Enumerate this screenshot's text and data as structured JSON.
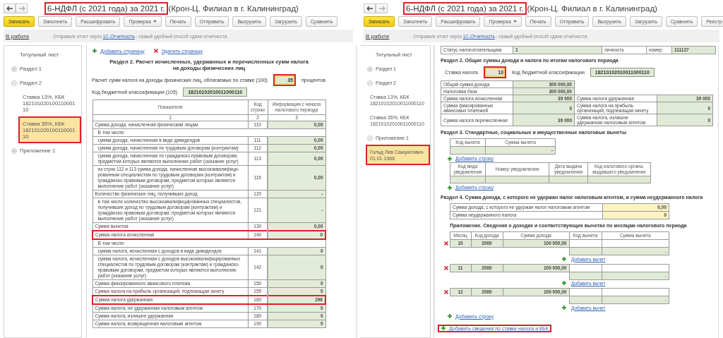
{
  "windows": [
    {
      "nav": {
        "title": "6-НДФЛ (с 2021 года) за 2021 г.",
        "subtitle": "(Крон-Ц. Филиал в г. Калининград)",
        "title_highlighted": true
      },
      "toolbar": [
        {
          "label": "Записать",
          "kind": "primary"
        },
        {
          "label": "Заполнить",
          "kind": "plain"
        },
        {
          "label": "Расшифровать",
          "kind": "plain"
        },
        {
          "label": "Проверка",
          "kind": "menu"
        },
        {
          "label": "Печать",
          "kind": "plain"
        },
        {
          "label": "Отправить",
          "kind": "plain"
        },
        {
          "label": "Выгрузить",
          "kind": "plain"
        },
        {
          "label": "Загрузить",
          "kind": "plain"
        },
        {
          "label": "Сравнить",
          "kind": "plain"
        }
      ],
      "status_link": "В работе",
      "notice": {
        "before": "Отправьте отчет через",
        "link": "1С-Отчетность",
        "after": "- самый удобный способ сдачи отчетности."
      },
      "sidebar": [
        {
          "label": "Титульный лист",
          "selected": false,
          "highlighted": false
        },
        {
          "label": "Раздел 1",
          "expanded": false,
          "selected": false,
          "highlighted": false
        },
        {
          "label": "Раздел 2",
          "expanded": true,
          "selected": false,
          "highlighted": false,
          "children": [
            {
              "label": "Ставка 13%, КБК 18210102010011000110",
              "selected": false,
              "highlighted": false
            },
            {
              "label": "Ставка 35%, КБК 18210102010011000110",
              "selected": true,
              "highlighted": true
            }
          ]
        },
        {
          "label": "Приложение 1",
          "expanded": false,
          "selected": false,
          "highlighted": false
        }
      ],
      "blocks": [
        {
          "kind": "page_links",
          "links": [
            {
              "kind": "add",
              "text": "Добавить страницу"
            },
            {
              "kind": "remove",
              "text": "Удалить страницу"
            }
          ]
        },
        {
          "kind": "title",
          "text": "Раздел 2. Расчет исчисленных, удержанных и перечисленных сумм налога на доходы физических лиц"
        },
        {
          "kind": "rate_line",
          "label": "Расчет сумм налога на доходы физических лиц, облагаемых по ставке  (100)",
          "value": "35",
          "suffix": "процентов",
          "highlighted": true
        },
        {
          "kind": "kbk_line",
          "label": "Код бюджетной классификации  (105)",
          "value": "18210102010011000110"
        },
        {
          "kind": "indicator_table",
          "columns": [
            "Показатели",
            "Код строки",
            "Информация с начала налогового периода"
          ],
          "numbers": [
            "1",
            "2",
            "3"
          ],
          "rows": [
            {
              "kind": "main",
              "label": "Сумма дохода, начисленная физическим лицам",
              "code": "110",
              "value": "0,00",
              "highlighted": false
            },
            {
              "kind": "note",
              "label": "В том числе:",
              "highlighted": false
            },
            {
              "kind": "sub",
              "label": "сумма дохода, начисленная в виде дивидендов",
              "code": "111",
              "value": "0,00",
              "highlighted": false
            },
            {
              "kind": "sub",
              "label": "сумма дохода, начисленная по трудовым договорам (контрактам)",
              "code": "112",
              "value": "0,00",
              "highlighted": false
            },
            {
              "kind": "sub",
              "label": "сумма дохода, начисленная по гражданско-правовым договорам, предметом которых являются выполнение работ (оказание услуг)",
              "code": "113",
              "value": "0,00",
              "highlighted": false
            },
            {
              "kind": "sub",
              "label": "из строк 112 и 113 сумма дохода, начисленная высококвалифици-рованным специалистам по трудовым договорам (контрактам) и гражданско-правовым договорам, предметом которых являются выполнение работ (оказание услуг)",
              "code": "115",
              "value": "0,00",
              "highlighted": false
            },
            {
              "kind": "main",
              "label": "Количество физических лиц, получивших доход",
              "code": "120",
              "value": "-",
              "highlighted": false
            },
            {
              "kind": "sub",
              "label": "в том числе количество высококвалифицированных специалистов, получивших доход по трудовым договорам (контрактам) и гражданско-правовым договорам, предметом которых являются выполнение работ (оказание услуг)",
              "code": "121",
              "value": "-",
              "highlighted": false
            },
            {
              "kind": "main",
              "label": "Сумма вычетов",
              "code": "130",
              "value": "0,00",
              "highlighted": false
            },
            {
              "kind": "main",
              "label": "Сумма налога исчисленная",
              "code": "140",
              "value": "0",
              "highlighted": true
            },
            {
              "kind": "note",
              "label": "В том числе:",
              "highlighted": false
            },
            {
              "kind": "sub",
              "label": "сумма налога, исчисленная с доходов в виде дивидендов",
              "code": "141",
              "value": "0",
              "highlighted": false
            },
            {
              "kind": "sub",
              "label": "сумма налога, исчисленная с доходов высококвалифицированных специалистов по трудовым договорам (контрактам) и гражданско-правовым договорам, предметом которых являются выполнение работ (оказание услуг)",
              "code": "142",
              "value": "0",
              "highlighted": false
            },
            {
              "kind": "main",
              "label": "Сумма фиксированного авансового платежа",
              "code": "150",
              "value": "0",
              "highlighted": false
            },
            {
              "kind": "main",
              "label": "Сумма налога на прибыль организаций, подлежащая зачету",
              "code": "155",
              "value": "0",
              "highlighted": false
            },
            {
              "kind": "main",
              "label": "Сумма налога удержанная",
              "code": "160",
              "value": "296",
              "highlighted": true
            },
            {
              "kind": "main",
              "label": "Сумма налога, не удержанная налоговым агентом",
              "code": "170",
              "value": "0",
              "highlighted": false
            },
            {
              "kind": "main",
              "label": "Сумма налога, излишне удержанная",
              "code": "180",
              "value": "0",
              "highlighted": false
            },
            {
              "kind": "main",
              "label": "Сумма налога, возвращенная налоговым агентом",
              "code": "190",
              "value": "0",
              "highlighted": false
            }
          ]
        }
      ]
    },
    {
      "nav": {
        "title": "6-НДФЛ (с 2021 года) за 2021 г.",
        "subtitle": "(Крон-Ц. Филиал в г. Калининград)",
        "title_highlighted": true
      },
      "toolbar": [
        {
          "label": "Записать",
          "kind": "primary"
        },
        {
          "label": "Заполнить",
          "kind": "plain"
        },
        {
          "label": "Расшифровать",
          "kind": "plain"
        },
        {
          "label": "Проверка",
          "kind": "menu"
        },
        {
          "label": "Печать",
          "kind": "plain"
        },
        {
          "label": "Отправить",
          "kind": "plain"
        },
        {
          "label": "Выгрузить",
          "kind": "plain"
        },
        {
          "label": "Загрузить",
          "kind": "plain"
        },
        {
          "label": "Сравнить",
          "kind": "plain"
        },
        {
          "label": "Реестр",
          "kind": "plain"
        }
      ],
      "status_link": "В работе",
      "notice": {
        "before": "Отправьте отчет через",
        "link": "1С-Отчетность",
        "after": "- самый удобный способ сдачи отчетности."
      },
      "sidebar": [
        {
          "label": "Титульный лист",
          "selected": false,
          "highlighted": false
        },
        {
          "label": "Раздел 1",
          "expanded": false,
          "selected": false,
          "highlighted": false
        },
        {
          "label": "Раздел 2",
          "expanded": true,
          "selected": false,
          "highlighted": false,
          "children": [
            {
              "label": "Ставка 13%, КБК 18210102010011000110",
              "selected": false,
              "highlighted": false
            },
            {
              "label": "Ставка 35%, КБК 18210102010011000110",
              "selected": false,
              "highlighted": false
            }
          ]
        },
        {
          "label": "Приложение 1",
          "expanded": true,
          "selected": false,
          "highlighted": false,
          "children": [
            {
              "label": "Гольд Лев Самуилович 01.01.1966",
              "selected": true,
              "highlighted": true
            }
          ]
        }
      ],
      "blocks": [
        {
          "kind": "status_grid",
          "rows": [
            [
              {
                "kind": "label",
                "text": "Статус налогоплательщика"
              },
              {
                "kind": "calc",
                "text": "1"
              },
              {
                "kind": "label",
                "text": "личность"
              },
              {
                "kind": "label",
                "text": "номер"
              },
              {
                "kind": "calc",
                "text": "111127"
              }
            ]
          ]
        },
        {
          "kind": "heading",
          "text": "Раздел 2. Общие суммы дохода и налога по итогам налогового периода"
        },
        {
          "kind": "rate_kbk",
          "rate_label": "Ставка налога",
          "rate": "13",
          "highlighted": true,
          "kbk_label": "Код бюджетной классификации",
          "kbk": "18210102010011000110"
        },
        {
          "kind": "summary_grid",
          "rows": [
            [
              {
                "kind": "label",
                "text": "Общая сумма дохода"
              },
              {
                "kind": "calc",
                "text": "300 000,00"
              }
            ],
            [
              {
                "kind": "label",
                "text": "Налоговая база"
              },
              {
                "kind": "calc",
                "text": "300 000,00"
              }
            ],
            [
              {
                "kind": "label",
                "text": "Сумма налога исчисленная"
              },
              {
                "kind": "calc",
                "text": "39 000"
              },
              {
                "kind": "label",
                "text": "Сумма налога удержанная"
              },
              {
                "kind": "calc",
                "text": "39 000"
              }
            ],
            [
              {
                "kind": "label",
                "text": "Сумма фиксированных авансовых платежей"
              },
              {
                "kind": "calc",
                "text": "0"
              },
              {
                "kind": "label",
                "text": "Сумма налога на прибыль организаций, подлежащая зачету"
              },
              {
                "kind": "calc",
                "text": "0"
              }
            ],
            [
              {
                "kind": "label",
                "text": "Сумма налога перечисленная"
              },
              {
                "kind": "calc",
                "text": "39 000"
              },
              {
                "kind": "label",
                "text": "Сумма налога, излишне удержанная налоговым агентом"
              },
              {
                "kind": "calc",
                "text": "0"
              }
            ]
          ]
        },
        {
          "kind": "heading",
          "text": "Раздел 3. Стандартные, социальные и имущественные налоговые вычеты"
        },
        {
          "kind": "deduction_grid",
          "rows": [
            [
              {
                "kind": "head",
                "text": "Код вычета"
              },
              {
                "kind": "head",
                "text": "Сумма вычета"
              }
            ],
            [
              {
                "kind": "calc"
              },
              {
                "kind": "calc",
                "text": "-"
              }
            ]
          ]
        },
        {
          "kind": "add_link",
          "text": "Добавить строку",
          "highlighted": false
        },
        {
          "kind": "notice_grid",
          "rows": [
            [
              {
                "kind": "head",
                "text": "Код вида уведомления"
              },
              {
                "kind": "head",
                "text": "Номер уведомления"
              },
              {
                "kind": "head",
                "text": "Дата выдачи уведомления"
              },
              {
                "kind": "head",
                "text": "Код налогового органа, выдавшего уведомление"
              }
            ],
            [
              {
                "kind": "calc"
              },
              {
                "kind": "calc"
              },
              {
                "kind": "calc"
              },
              {
                "kind": "calc"
              }
            ]
          ]
        },
        {
          "kind": "add_link",
          "text": "Добавить строку",
          "highlighted": false
        },
        {
          "kind": "heading",
          "text": "Раздел 4. Сумма дохода, с которого не удержан налог налоговым агентом, и сумма неудержанного налога"
        },
        {
          "kind": "arrears_grid",
          "rows": [
            [
              {
                "kind": "label",
                "text": "Сумма дохода, с которого не удержан налог налоговым агентом"
              },
              {
                "kind": "input",
                "text": "0,00"
              }
            ],
            [
              {
                "kind": "label",
                "text": "Сумма неудержанного налога"
              },
              {
                "kind": "input",
                "text": "0"
              }
            ]
          ]
        },
        {
          "kind": "appendix",
          "title": "Приложение. Сведения о доходах и соответствующих вычетах по месяцам налогового периода",
          "columns": [
            "Месяц",
            "Код дохода",
            "Сумма дохода",
            "Код вычета",
            "Сумма вычета"
          ],
          "entries": [
            {
              "month": "10",
              "code": "2000",
              "amount": "100 000,00",
              "deduction_amount": "-",
              "add_link": "Добавить вычет"
            },
            {
              "month": "11",
              "code": "2000",
              "amount": "100 000,00",
              "deduction_amount": "-",
              "add_link": "Добавить вычет"
            },
            {
              "month": "12",
              "code": "2000",
              "amount": "100 000,00",
              "deduction_amount": "-",
              "add_link": "Добавить вычет"
            }
          ],
          "add_row": "Добавить строку"
        },
        {
          "kind": "add_link",
          "text": "Добавить сведения по ставке налога и КБК",
          "highlighted": true
        }
      ]
    }
  ]
}
